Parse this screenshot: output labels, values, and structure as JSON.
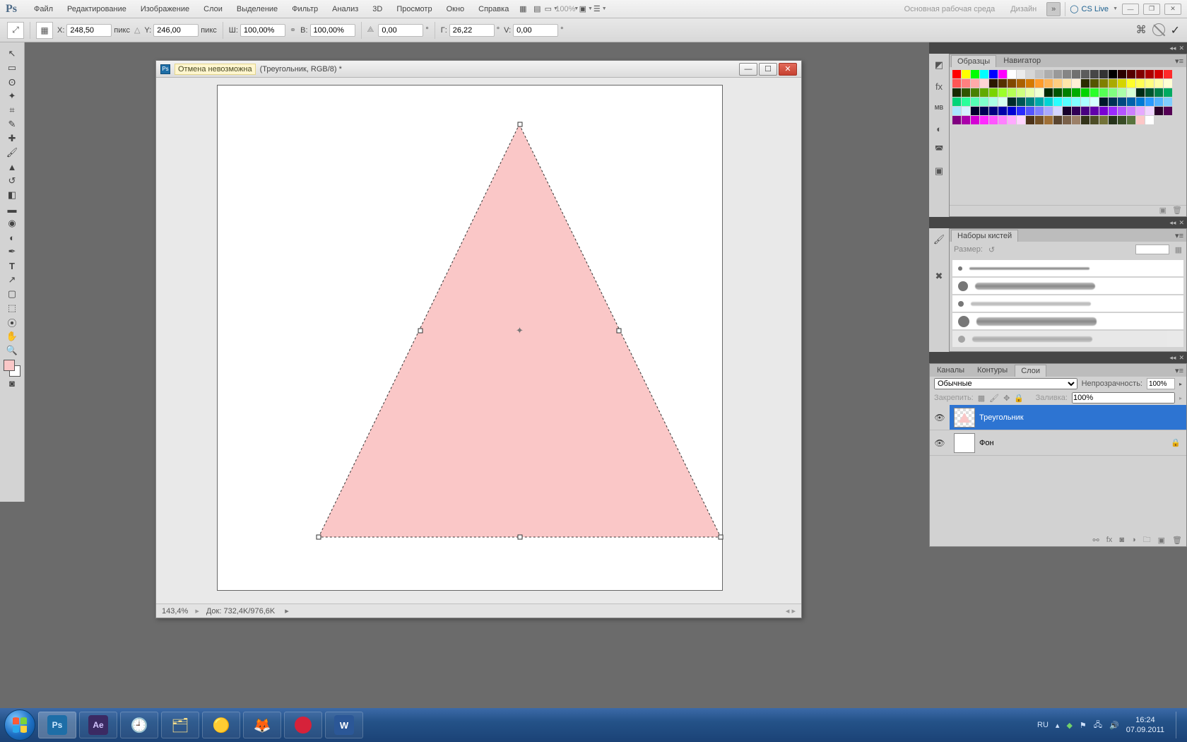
{
  "app": {
    "logo": "Ps"
  },
  "menu": [
    "Файл",
    "Редактирование",
    "Изображение",
    "Слои",
    "Выделение",
    "Фильтр",
    "Анализ",
    "3D",
    "Просмотр",
    "Окно",
    "Справка"
  ],
  "topRight": {
    "zoom": "100%",
    "workspaces": [
      "Основная рабочая среда",
      "Дизайн"
    ],
    "csLive": "CS Live"
  },
  "options": {
    "xLabel": "X:",
    "x": "248,50",
    "xUnit": "пикс",
    "yLabel": "Y:",
    "y": "246,00",
    "yUnit": "пикс",
    "wLabel": "Ш:",
    "w": "100,00%",
    "hLabel": "В:",
    "h": "100,00%",
    "angleLabel": "",
    "angle": "0,00",
    "angleUnit": "°",
    "hLabel2": "Г:",
    "hskew": "26,22",
    "hskewUnit": "°",
    "vLabel": "V:",
    "vskew": "0,00",
    "vskewUnit": "°"
  },
  "document": {
    "undoTip": "Отмена невозможна",
    "title": "(Треугольник, RGB/8) *",
    "zoom": "143,4%",
    "docSize": "Док: 732,4K/976,6K"
  },
  "panels": {
    "swatches": {
      "tabs": [
        "Образцы",
        "Навигатор"
      ]
    },
    "brushes": {
      "tab": "Наборы кистей",
      "sizeLabel": "Размер:"
    },
    "layers": {
      "tabs": [
        "Каналы",
        "Контуры",
        "Слои"
      ],
      "blend": "Обычные",
      "opacityLabel": "Непрозрачность:",
      "opacity": "100%",
      "lockLabel": "Закрепить:",
      "fillLabel": "Заливка:",
      "fill": "100%",
      "items": [
        {
          "name": "Треугольник",
          "selected": true
        },
        {
          "name": "Фон",
          "selected": false,
          "locked": true
        }
      ]
    }
  },
  "taskbar": {
    "lang": "RU",
    "time": "16:24",
    "date": "07.09.2011"
  },
  "swatchColors": [
    "#ff0000",
    "#ffff00",
    "#00ff00",
    "#00ffff",
    "#0000ff",
    "#ff00ff",
    "#ffffff",
    "#ebebeb",
    "#d6d6d6",
    "#c2c2c2",
    "#adadad",
    "#999999",
    "#858585",
    "#707070",
    "#5c5c5c",
    "#474747",
    "#333333",
    "#000000",
    "#2b0000",
    "#550000",
    "#800000",
    "#aa0000",
    "#d40000",
    "#ff2a2a",
    "#ff5555",
    "#ff8080",
    "#ffaaaa",
    "#ffd5d5",
    "#2b1700",
    "#553000",
    "#804800",
    "#aa6100",
    "#d47900",
    "#ff9b2a",
    "#ffb455",
    "#ffcd80",
    "#ffe6aa",
    "#fff0d5",
    "#2b2b00",
    "#555500",
    "#808000",
    "#aaaa00",
    "#d4d400",
    "#ffff2a",
    "#ffff55",
    "#ffff80",
    "#ffffaa",
    "#ffffd5",
    "#172b00",
    "#305500",
    "#488000",
    "#61aa00",
    "#79d400",
    "#9bff2a",
    "#b4ff55",
    "#cdff80",
    "#e6ffaa",
    "#f0ffd5",
    "#002b00",
    "#005500",
    "#008000",
    "#00aa00",
    "#00d400",
    "#2aff2a",
    "#55ff55",
    "#80ff80",
    "#aaffaa",
    "#d5ffd5",
    "#002b17",
    "#005530",
    "#008048",
    "#00aa61",
    "#00d479",
    "#2aff9b",
    "#55ffb4",
    "#80ffcd",
    "#aaffe6",
    "#d5fff0",
    "#002b2b",
    "#005555",
    "#008080",
    "#00aaaa",
    "#00d4d4",
    "#2affff",
    "#55ffff",
    "#80ffff",
    "#aaffff",
    "#d5ffff",
    "#00172b",
    "#003055",
    "#004880",
    "#0061aa",
    "#0079d4",
    "#2a9bff",
    "#55b4ff",
    "#80cdff",
    "#aae6ff",
    "#d5f0ff",
    "#00002b",
    "#000055",
    "#000080",
    "#0000aa",
    "#0000d4",
    "#2a2aff",
    "#5555ff",
    "#8080ff",
    "#aaaaff",
    "#d5d5ff",
    "#17002b",
    "#300055",
    "#480080",
    "#6100aa",
    "#7900d4",
    "#9b2aff",
    "#b455ff",
    "#cd80ff",
    "#e6aaff",
    "#f0d5ff",
    "#2b002b",
    "#550055",
    "#800080",
    "#aa00aa",
    "#d400d4",
    "#ff2aff",
    "#ff55ff",
    "#ff80ff",
    "#ffaaff",
    "#ffd5ff",
    "#4d3319",
    "#735026",
    "#a07037",
    "#5a4530",
    "#7a614a",
    "#9c8068",
    "#33331a",
    "#4d4d26",
    "#737339",
    "#26331a",
    "#394d26",
    "#59733d",
    "#fcc7c7",
    "#ffffff"
  ]
}
